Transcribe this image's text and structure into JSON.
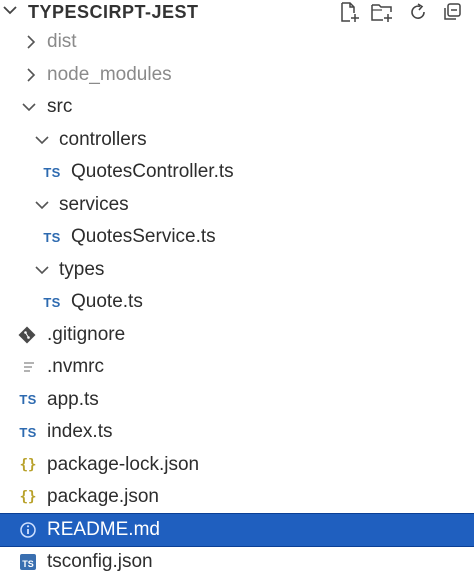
{
  "explorer": {
    "title": "TYPESCIRPT-JEST",
    "actions": [
      {
        "name": "new-file-icon"
      },
      {
        "name": "new-folder-icon"
      },
      {
        "name": "refresh-icon"
      },
      {
        "name": "collapse-all-icon"
      }
    ]
  },
  "tree": [
    {
      "label": "dist",
      "kind": "folder",
      "expanded": false,
      "depth": 0,
      "dim": true
    },
    {
      "label": "node_modules",
      "kind": "folder",
      "expanded": false,
      "depth": 0,
      "dim": true
    },
    {
      "label": "src",
      "kind": "folder",
      "expanded": true,
      "depth": 0
    },
    {
      "label": "controllers",
      "kind": "folder",
      "expanded": true,
      "depth": 1
    },
    {
      "label": "QuotesController.ts",
      "kind": "ts",
      "depth": 2,
      "icon_text": "TS"
    },
    {
      "label": "services",
      "kind": "folder",
      "expanded": true,
      "depth": 1
    },
    {
      "label": "QuotesService.ts",
      "kind": "ts",
      "depth": 2,
      "icon_text": "TS"
    },
    {
      "label": "types",
      "kind": "folder",
      "expanded": true,
      "depth": 1
    },
    {
      "label": "Quote.ts",
      "kind": "ts",
      "depth": 2,
      "icon_text": "TS"
    },
    {
      "label": ".gitignore",
      "kind": "git",
      "depth": 0
    },
    {
      "label": ".nvmrc",
      "kind": "text",
      "depth": 0
    },
    {
      "label": "app.ts",
      "kind": "ts",
      "depth": -1,
      "icon_text": "TS"
    },
    {
      "label": "index.ts",
      "kind": "ts",
      "depth": -1,
      "icon_text": "TS"
    },
    {
      "label": "package-lock.json",
      "kind": "json",
      "depth": -1,
      "icon_text": "{}"
    },
    {
      "label": "package.json",
      "kind": "json",
      "depth": -1,
      "icon_text": "{}"
    },
    {
      "label": "README.md",
      "kind": "info",
      "depth": -1,
      "selected": true
    },
    {
      "label": "tsconfig.json",
      "kind": "tsconfig",
      "depth": -1,
      "icon_text": "TS"
    }
  ],
  "colors": {
    "selected_bg": "#1f5fbf",
    "ts_blue": "#2d6ab0",
    "json_yellow": "#b8a12a",
    "git_gray": "#4a4a4a"
  }
}
